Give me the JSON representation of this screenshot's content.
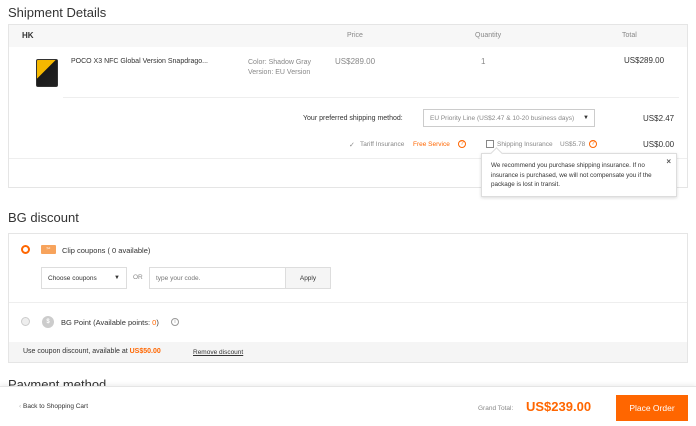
{
  "shipment": {
    "title": "Shipment Details",
    "warehouse": "HK",
    "columns": {
      "price": "Price",
      "quantity": "Quantity",
      "total": "Total"
    },
    "product": {
      "name": "POCO X3 NFC Global Version Snapdrago...",
      "color": "Color: Shadow Gray",
      "version": "Version: EU Version",
      "price": "US$289.00",
      "quantity": "1",
      "total": "US$289.00"
    },
    "shipping_label": "Your preferred shipping method:",
    "shipping_method": "EU Priority Line (US$2.47 & 10-20 business days)",
    "shipping_cost": "US$2.47",
    "tariff_label": "Tariff Insurance",
    "tariff_status": "Free Service",
    "insurance_label": "Shipping Insurance",
    "insurance_price": "US$5.78",
    "insurance_cost": "US$0.00",
    "tooltip": "We recommend you purchase shipping insurance. If no insurance is purchased, we will not compensate you if the package is lost in transit."
  },
  "discount": {
    "title": "BG discount",
    "clip_label": "Clip coupons ( 0 available)",
    "choose_coupons": "Choose coupons",
    "or": "OR",
    "code_placeholder": "type your code.",
    "apply_label": "Apply",
    "bgpoint_label": "BG Point (Available points: ",
    "bgpoint_value": "0",
    "bgpoint_close": ")",
    "coupon_text": "Use coupon discount, available at ",
    "coupon_amount": "US$50.00",
    "remove_label": "Remove discount"
  },
  "payment": {
    "title": "Payment method"
  },
  "footer": {
    "back_label": "Back to Shopping Cart",
    "grand_label": "Grand Total:",
    "grand_total": "US$239.00",
    "place_order": "Place Order"
  },
  "colors": {
    "accent": "#ff6600"
  },
  "icons": [
    "tariff-check-icon",
    "question-icon",
    "close-icon",
    "clip-coupon-icon",
    "bg-point-icon",
    "info-icon",
    "chevron-down-icon",
    "chevron-left-icon"
  ]
}
